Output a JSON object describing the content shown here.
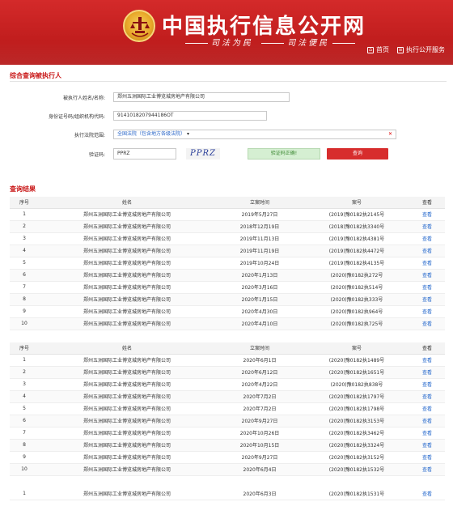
{
  "header": {
    "site_title": "中国执行信息公开网",
    "slogan_left": "司法为民",
    "slogan_right": "司法便民",
    "nav": [
      {
        "label": "首页",
        "icon": "home-icon"
      },
      {
        "label": "执行公开服务",
        "icon": "document-icon"
      }
    ]
  },
  "search": {
    "section_title": "综合查询被执行人",
    "name_label": "被执行人姓名/名称:",
    "name_value": "郑州五洲国际工业博览城房地产有限公司",
    "id_label": "身份证号码/组织机构代码:",
    "id_value": "9141018207944186OT",
    "court_label": "执行法院范围:",
    "court_value": "全国法院（包含地方各级法院）",
    "captcha_label": "验证码:",
    "captcha_value": "PPRZ",
    "captcha_image_text": "PPRZ",
    "verify_status": "验证码正确!",
    "query_button": "查询"
  },
  "results": {
    "section_title": "查询结果",
    "columns": [
      "序号",
      "姓名",
      "立案时间",
      "案号",
      "查看"
    ],
    "table1": [
      {
        "idx": "1",
        "name": "郑州五洲国际工业博览城房地产有限公司",
        "date": "2019年5月27日",
        "case": "(2019)豫0182执2145号",
        "action": "查看"
      },
      {
        "idx": "2",
        "name": "郑州五洲国际工业博览城房地产有限公司",
        "date": "2018年12月19日",
        "case": "(2018)豫0182执3340号",
        "action": "查看"
      },
      {
        "idx": "3",
        "name": "郑州五洲国际工业博览城房地产有限公司",
        "date": "2019年11月13日",
        "case": "(2019)豫0182执4381号",
        "action": "查看"
      },
      {
        "idx": "4",
        "name": "郑州五洲国际工业博览城房地产有限公司",
        "date": "2019年11月19日",
        "case": "(2019)豫0182执4472号",
        "action": "查看"
      },
      {
        "idx": "5",
        "name": "郑州五洲国际工业博览城房地产有限公司",
        "date": "2019年10月24日",
        "case": "(2019)豫0182执4135号",
        "action": "查看"
      },
      {
        "idx": "6",
        "name": "郑州五洲国际工业博览城房地产有限公司",
        "date": "2020年1月13日",
        "case": "(2020)豫0182执272号",
        "action": "查看"
      },
      {
        "idx": "7",
        "name": "郑州五洲国际工业博览城房地产有限公司",
        "date": "2020年3月16日",
        "case": "(2020)豫0182执514号",
        "action": "查看"
      },
      {
        "idx": "8",
        "name": "郑州五洲国际工业博览城房地产有限公司",
        "date": "2020年1月15日",
        "case": "(2020)豫0182执333号",
        "action": "查看"
      },
      {
        "idx": "9",
        "name": "郑州五洲国际工业博览城房地产有限公司",
        "date": "2020年4月30日",
        "case": "(2020)豫0182执964号",
        "action": "查看"
      },
      {
        "idx": "10",
        "name": "郑州五洲国际工业博览城房地产有限公司",
        "date": "2020年4月10日",
        "case": "(2020)豫0182执725号",
        "action": "查看"
      }
    ],
    "table2": [
      {
        "idx": "1",
        "name": "郑州五洲国际工业博览城房地产有限公司",
        "date": "2020年6月1日",
        "case": "(2020)豫0182执1489号",
        "action": "查看"
      },
      {
        "idx": "2",
        "name": "郑州五洲国际工业博览城房地产有限公司",
        "date": "2020年6月12日",
        "case": "(2020)豫0182执1651号",
        "action": "查看"
      },
      {
        "idx": "3",
        "name": "郑州五洲国际工业博览城房地产有限公司",
        "date": "2020年4月22日",
        "case": "(2020)豫0182执838号",
        "action": "查看"
      },
      {
        "idx": "4",
        "name": "郑州五洲国际工业博览城房地产有限公司",
        "date": "2020年7月2日",
        "case": "(2020)豫0182执1797号",
        "action": "查看"
      },
      {
        "idx": "5",
        "name": "郑州五洲国际工业博览城房地产有限公司",
        "date": "2020年7月2日",
        "case": "(2020)豫0182执1798号",
        "action": "查看"
      },
      {
        "idx": "6",
        "name": "郑州五洲国际工业博览城房地产有限公司",
        "date": "2020年9月27日",
        "case": "(2020)豫0182执3153号",
        "action": "查看"
      },
      {
        "idx": "7",
        "name": "郑州五洲国际工业博览城房地产有限公司",
        "date": "2020年10月26日",
        "case": "(2020)豫0182执3462号",
        "action": "查看"
      },
      {
        "idx": "8",
        "name": "郑州五洲国际工业博览城房地产有限公司",
        "date": "2020年10月15日",
        "case": "(2020)豫0182执3324号",
        "action": "查看"
      },
      {
        "idx": "9",
        "name": "郑州五洲国际工业博览城房地产有限公司",
        "date": "2020年9月27日",
        "case": "(2020)豫0182执3152号",
        "action": "查看"
      },
      {
        "idx": "10",
        "name": "郑州五洲国际工业博览城房地产有限公司",
        "date": "2020年6月4日",
        "case": "(2020)豫0182执1532号",
        "action": "查看"
      }
    ],
    "table3": [
      {
        "idx": "1",
        "name": "郑州五洲国际工业博览城房地产有限公司",
        "date": "2020年6月3日",
        "case": "(2020)豫0182执1531号",
        "action": "查看"
      }
    ]
  }
}
